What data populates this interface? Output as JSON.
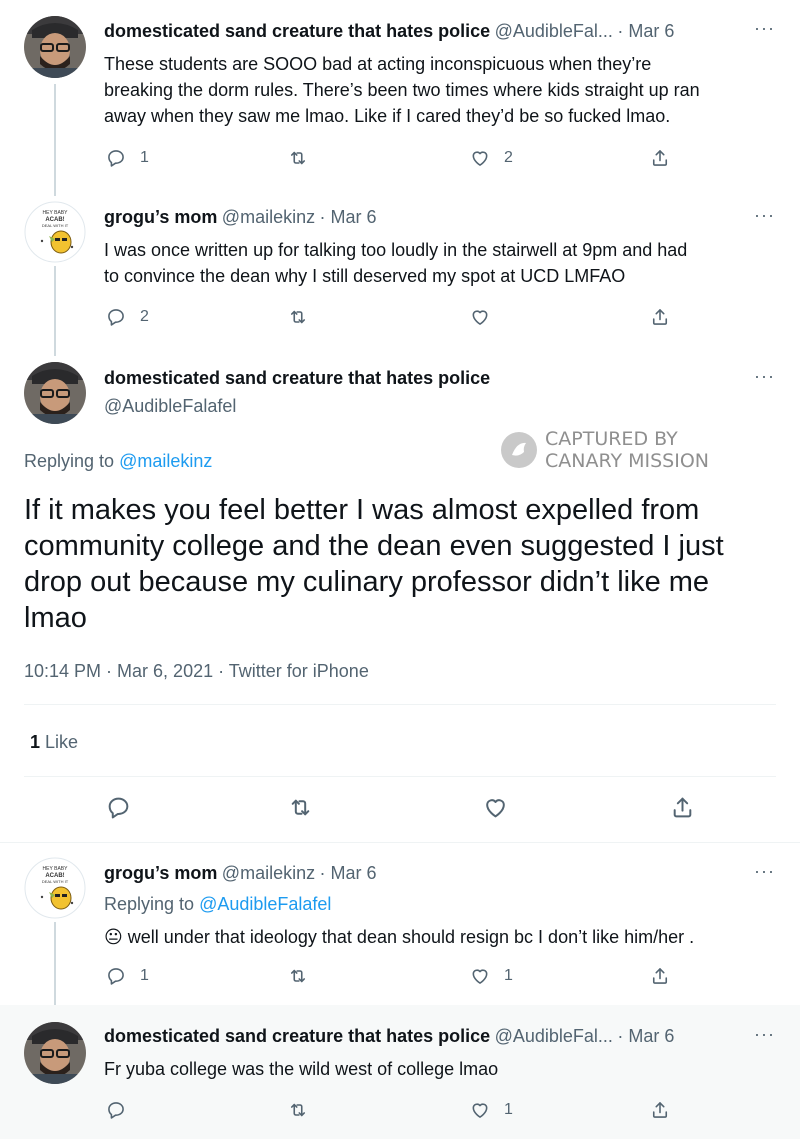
{
  "tweets": [
    {
      "name": "domesticated sand creature that hates police",
      "handle": "@AudibleFal...",
      "date": "· Mar 6",
      "text": [
        "These students are SOOO bad at acting inconspicuous when they’re",
        "breaking the dorm rules. There’s been two times where kids straight up ran",
        "away when they saw me lmao. Like if I cared they’d be so fucked lmao."
      ],
      "reply_count": "1",
      "like_count": "2"
    },
    {
      "name": "grogu’s mom",
      "handle": "@mailekinz",
      "date": "· Mar 6",
      "text": [
        "I was once written up for talking too loudly in the stairwell at 9pm and had",
        "to convince the dean why I still deserved my spot at UCD LMFAO"
      ],
      "reply_count": "2",
      "like_count": ""
    }
  ],
  "main": {
    "name": "domesticated sand creature that hates police",
    "handle": "@AudibleFalafel",
    "replying_prefix": "Replying to",
    "replying_to": "@mailekinz",
    "text": [
      "If it makes you feel better I was almost expelled from",
      "community college and the dean even suggested I just",
      "drop out because my culinary professor didn’t like me",
      "lmao"
    ],
    "timestamp": "10:14 PM · Mar 6, 2021 · Twitter for iPhone",
    "likes_count": "1",
    "likes_label": "Like"
  },
  "watermark": {
    "line1": "CAPTURED BY",
    "line2": "CANARY MISSION"
  },
  "replies": [
    {
      "name": "grogu’s mom",
      "handle": "@mailekinz",
      "date": "· Mar 6",
      "replying_prefix": "Replying to",
      "replying_to": "@AudibleFalafel",
      "emoji": "😐",
      "text": "well under that ideology that dean should resign bc I don’t like him/her .",
      "reply_count": "1",
      "like_count": "1"
    },
    {
      "name": "domesticated sand creature that hates police",
      "handle": "@AudibleFal...",
      "date": "· Mar 6",
      "text": "Fr yuba college was the wild west of college lmao",
      "reply_count": "",
      "like_count": "1"
    }
  ],
  "avatar_text": {
    "line1": "HEY BABY",
    "line2": "ACAB!",
    "line3": "DEAL WITH IT"
  },
  "more_label": "···",
  "colors": {
    "link": "#1d9bf0",
    "muted": "#536471",
    "thread_line": "#cfd9de",
    "highlight_bg": "#f7f9f9"
  }
}
